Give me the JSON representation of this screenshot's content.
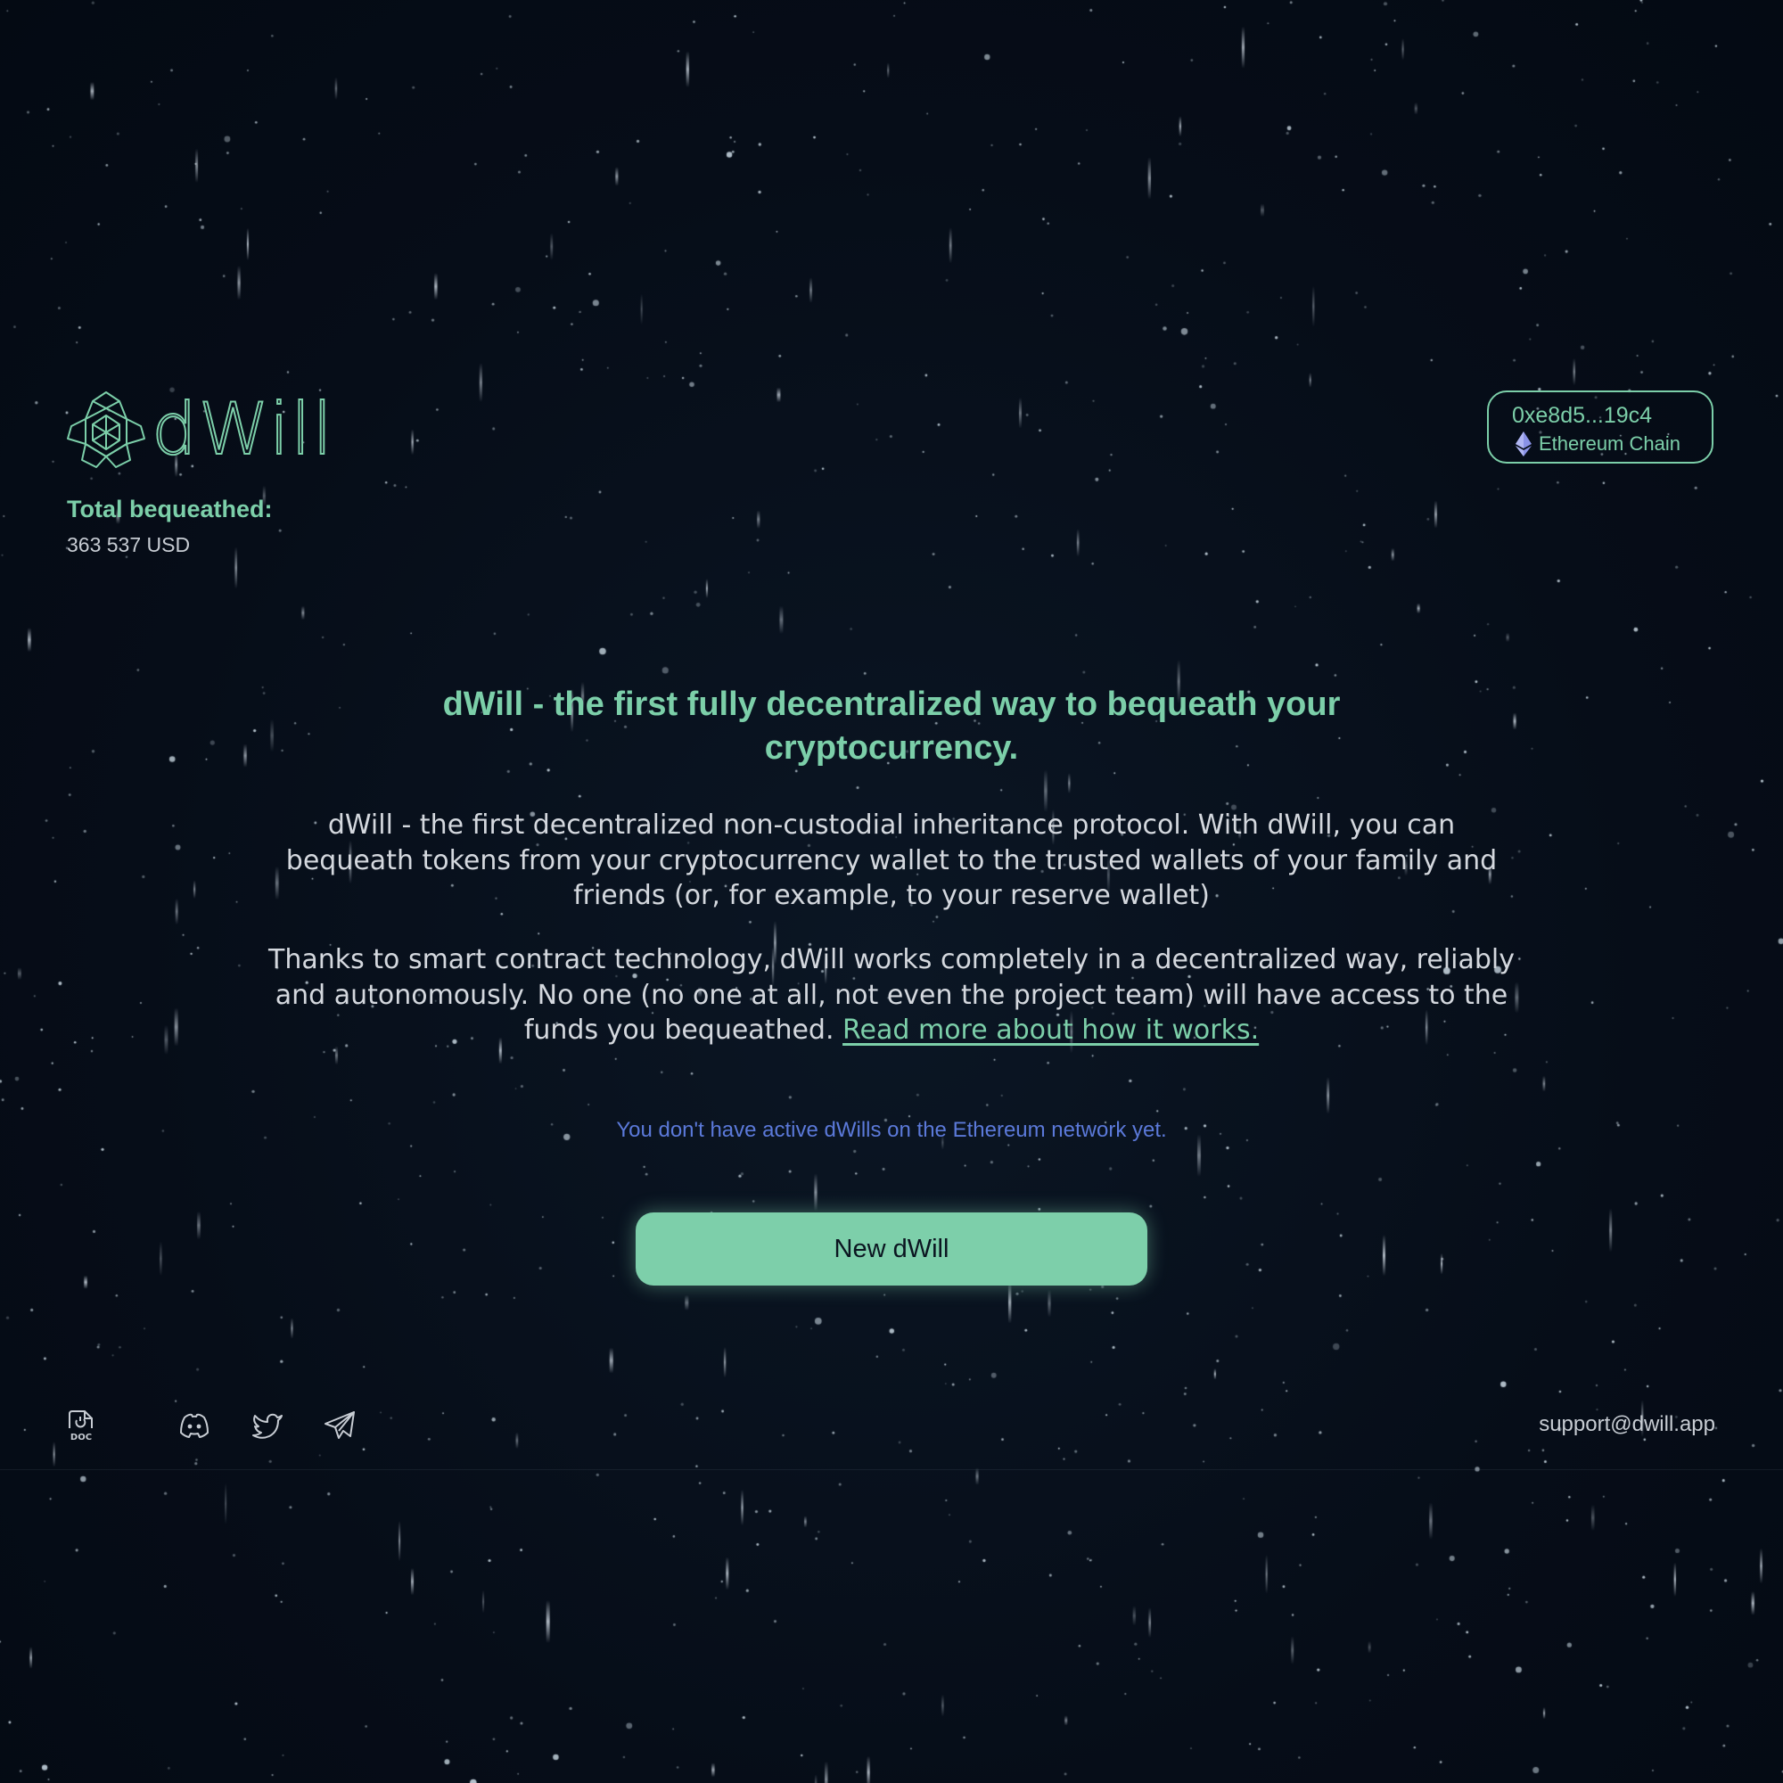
{
  "brand": {
    "name": "dWill",
    "accent_color": "#7ccfa9"
  },
  "stats": {
    "total_label": "Total bequeathed:",
    "total_value": "363 537 USD"
  },
  "wallet": {
    "address": "0xe8d5...19c4",
    "chain": "Ethereum Chain",
    "chain_icon": "ethereum-icon"
  },
  "hero": {
    "title": "dWill - the first fully decentralized way to bequeath your cryptocurrency.",
    "paragraph1": "dWill - the first decentralized non-custodial inheritance protocol. With dWill, you can bequeath tokens from your cryptocurrency wallet to the trusted wallets of your family and friends (or, for example, to your reserve wallet)",
    "paragraph2": "Thanks to smart contract technology, dWill works completely in a decentralized way, reliably and autonomously. No one (no one at all, not even the project team) will have access to the funds you bequeathed.",
    "read_more": "Read more about how it works."
  },
  "notice": {
    "text": "You don't have active dWills on the Ethereum network yet.",
    "color": "#5b79d9"
  },
  "actions": {
    "new_will": "New dWill"
  },
  "footer": {
    "icons": [
      "doc-icon",
      "discord-icon",
      "twitter-icon",
      "telegram-icon"
    ],
    "support_email": "support@dwill.app"
  }
}
